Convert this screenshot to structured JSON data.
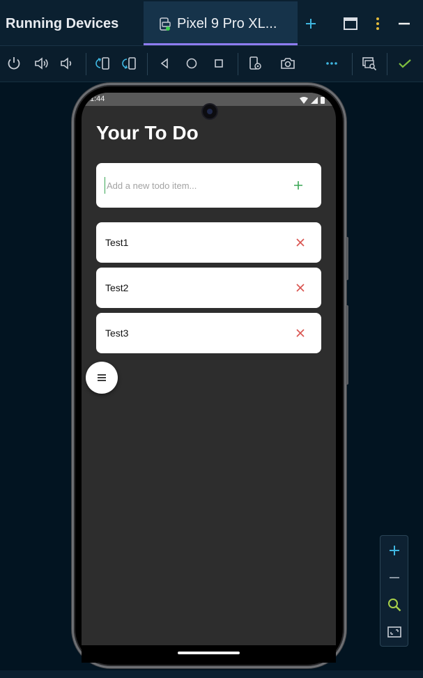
{
  "window": {
    "title": "Running Devices",
    "device_tab_label": "Pixel 9 Pro XL..."
  },
  "colors": {
    "background": "#021421",
    "accent_tab": "#8e7cf0",
    "add_plus": "#3aa655",
    "delete_x": "#d9534f",
    "check": "#7fbf3f"
  },
  "toolbar": {
    "icons": [
      "power-icon",
      "volume-up-icon",
      "volume-down-icon",
      "rotate-left-icon",
      "rotate-right-icon",
      "back-icon",
      "home-icon",
      "overview-icon",
      "device-settings-icon",
      "camera-icon",
      "more-icon",
      "mirror-search-icon",
      "check-icon"
    ]
  },
  "device": {
    "status_time": "1:44",
    "app": {
      "title": "Your To Do",
      "input_placeholder": "Add a new todo item...",
      "input_value": "",
      "todos": [
        {
          "text": "Test1"
        },
        {
          "text": "Test2"
        },
        {
          "text": "Test3"
        }
      ]
    }
  },
  "zoom_panel": {
    "icons": [
      "zoom-in-icon",
      "zoom-out-icon",
      "zoom-actual-size-icon",
      "zoom-fit-icon"
    ]
  }
}
